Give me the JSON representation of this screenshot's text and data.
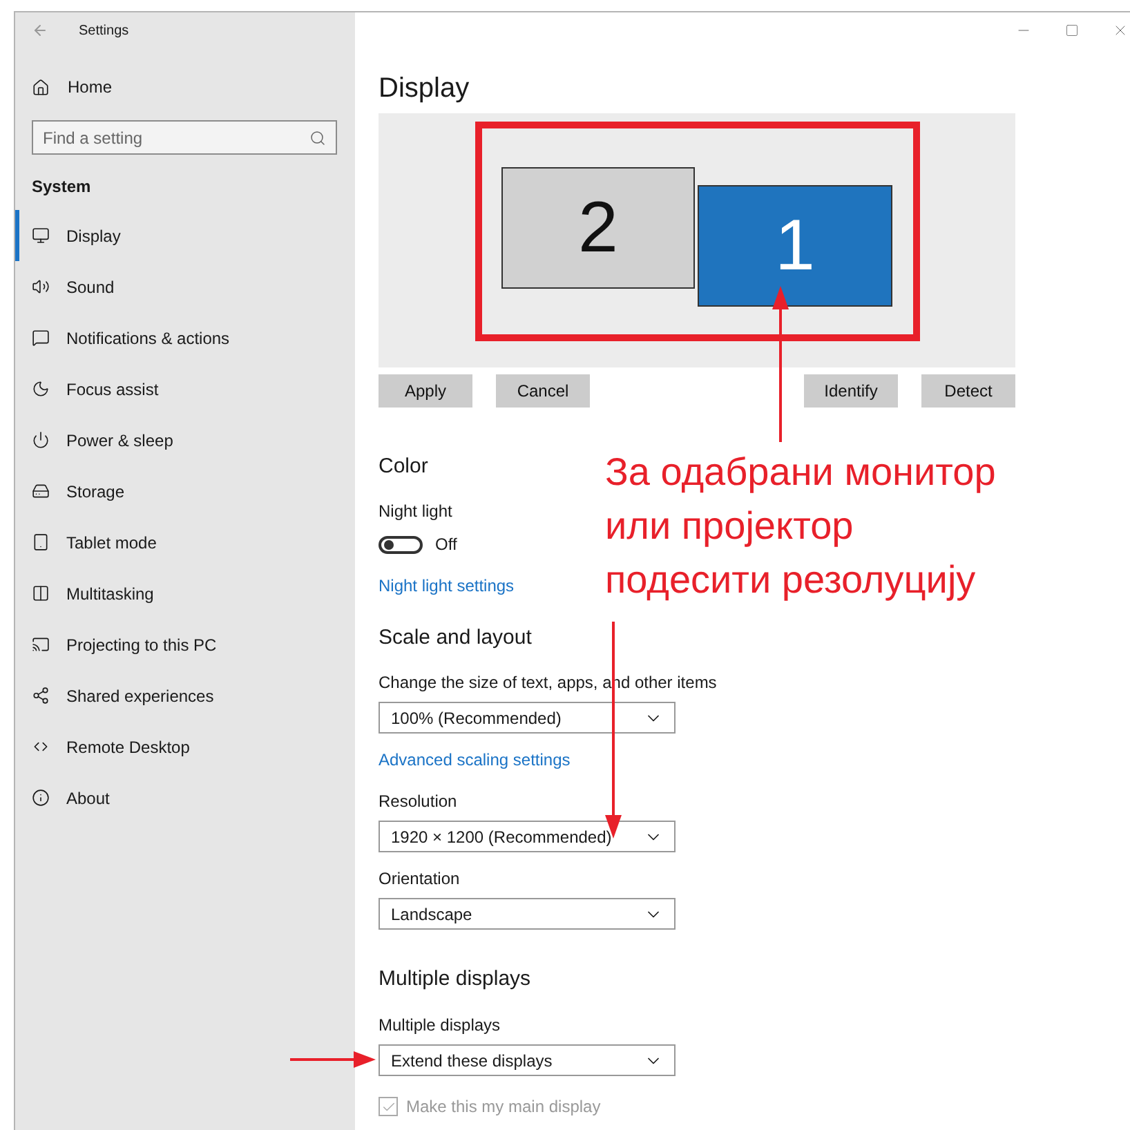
{
  "window": {
    "title": "Settings"
  },
  "sidebar": {
    "home": "Home",
    "search": {
      "placeholder": "Find a setting"
    },
    "section": "System",
    "items": [
      {
        "label": "Display",
        "selected": true
      },
      {
        "label": "Sound",
        "selected": false
      },
      {
        "label": "Notifications & actions",
        "selected": false
      },
      {
        "label": "Focus assist",
        "selected": false
      },
      {
        "label": "Power & sleep",
        "selected": false
      },
      {
        "label": "Storage",
        "selected": false
      },
      {
        "label": "Tablet mode",
        "selected": false
      },
      {
        "label": "Multitasking",
        "selected": false
      },
      {
        "label": "Projecting to this PC",
        "selected": false
      },
      {
        "label": "Shared experiences",
        "selected": false
      },
      {
        "label": "Remote Desktop",
        "selected": false
      },
      {
        "label": "About",
        "selected": false
      }
    ]
  },
  "main": {
    "title": "Display",
    "arrangement": {
      "monitors": [
        {
          "label": "2",
          "selected": false
        },
        {
          "label": "1",
          "selected": true
        }
      ],
      "buttons": [
        "Apply",
        "Cancel",
        "Identify",
        "Detect"
      ]
    },
    "color": {
      "heading": "Color",
      "night_light": {
        "label": "Night light",
        "on": false,
        "state_text": "Off"
      },
      "link": "Night light settings"
    },
    "scale": {
      "heading": "Scale and layout",
      "size_label": "Change the size of text, apps, and other items",
      "size_value": "100% (Recommended)",
      "link": "Advanced scaling settings",
      "resolution_label": "Resolution",
      "resolution_value": "1920 × 1200 (Recommended)",
      "orientation_label": "Orientation",
      "orientation_value": "Landscape"
    },
    "multiple": {
      "heading": "Multiple displays",
      "label": "Multiple displays",
      "value": "Extend these displays",
      "main_display": {
        "label": "Make this my main display",
        "checked": true,
        "disabled": true
      }
    }
  },
  "annotation": {
    "lines": [
      "За одабрани монитор",
      "или пројектор",
      "подесити резолуцију"
    ]
  }
}
